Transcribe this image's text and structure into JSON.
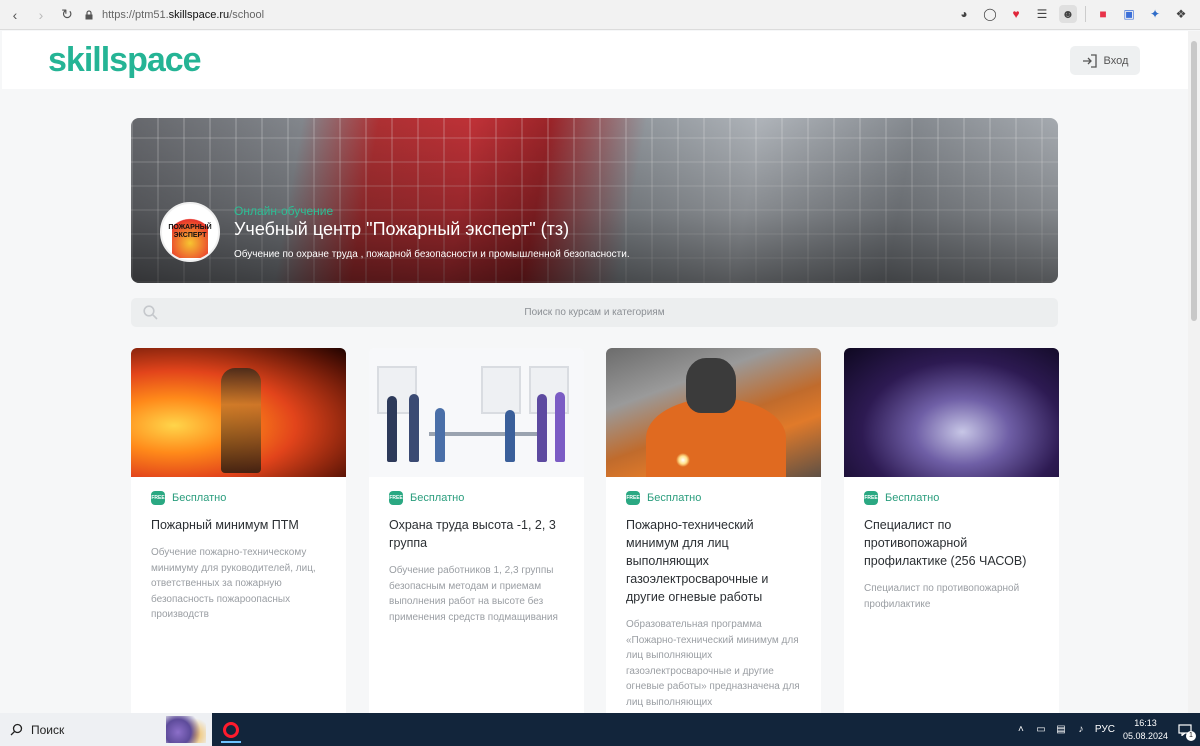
{
  "browser": {
    "url_prefix": "https://ptm51.",
    "url_domain": "skillspace.ru",
    "url_path": "/school"
  },
  "header": {
    "logo": "skillspace",
    "login_label": "Вход"
  },
  "hero": {
    "logo_text": "ПОЖАРНЫЙ ЭКСПЕРТ",
    "kicker": "Онлайн-обучение",
    "title": "Учебный центр \"Пожарный эксперт\" (тз)",
    "subtitle": "Обучение по охране труда , пожарной безопасности и промышленной безопасности."
  },
  "search": {
    "placeholder": "Поиск по курсам и категориям"
  },
  "courses": [
    {
      "badge_icon": "FREE",
      "price": "Бесплатно",
      "title": "Пожарный минимум ПТМ",
      "description": "Обучение пожарно-техническому минимуму для руководителей, лиц, ответственных за пожарную безопасность пожароопасных производств"
    },
    {
      "badge_icon": "FREE",
      "price": "Бесплатно",
      "title": "Охрана труда высота -1, 2, 3 группа",
      "description": "Обучение работников 1, 2,3 группы безопасным методам и приемам выполнения работ на высоте без применения средств подмащивания"
    },
    {
      "badge_icon": "FREE",
      "price": "Бесплатно",
      "title": "Пожарно-технический минимум для лиц выполняющих газоэлектросварочные и другие огневые работы",
      "description": "Образовательная программа «Пожарно-технический минимум для лиц выполняющих газоэлектросварочные и другие огневые работы» предназначена для лиц выполняющих"
    },
    {
      "badge_icon": "FREE",
      "price": "Бесплатно",
      "title": "Специалист по противопожарной профилактике (256 ЧАСОВ)",
      "description": "Специалист по противопожарной профилактике"
    }
  ],
  "taskbar": {
    "search_label": "Поиск",
    "language": "РУС",
    "time": "16:13",
    "date": "05.08.2024",
    "notification_count": "1"
  }
}
